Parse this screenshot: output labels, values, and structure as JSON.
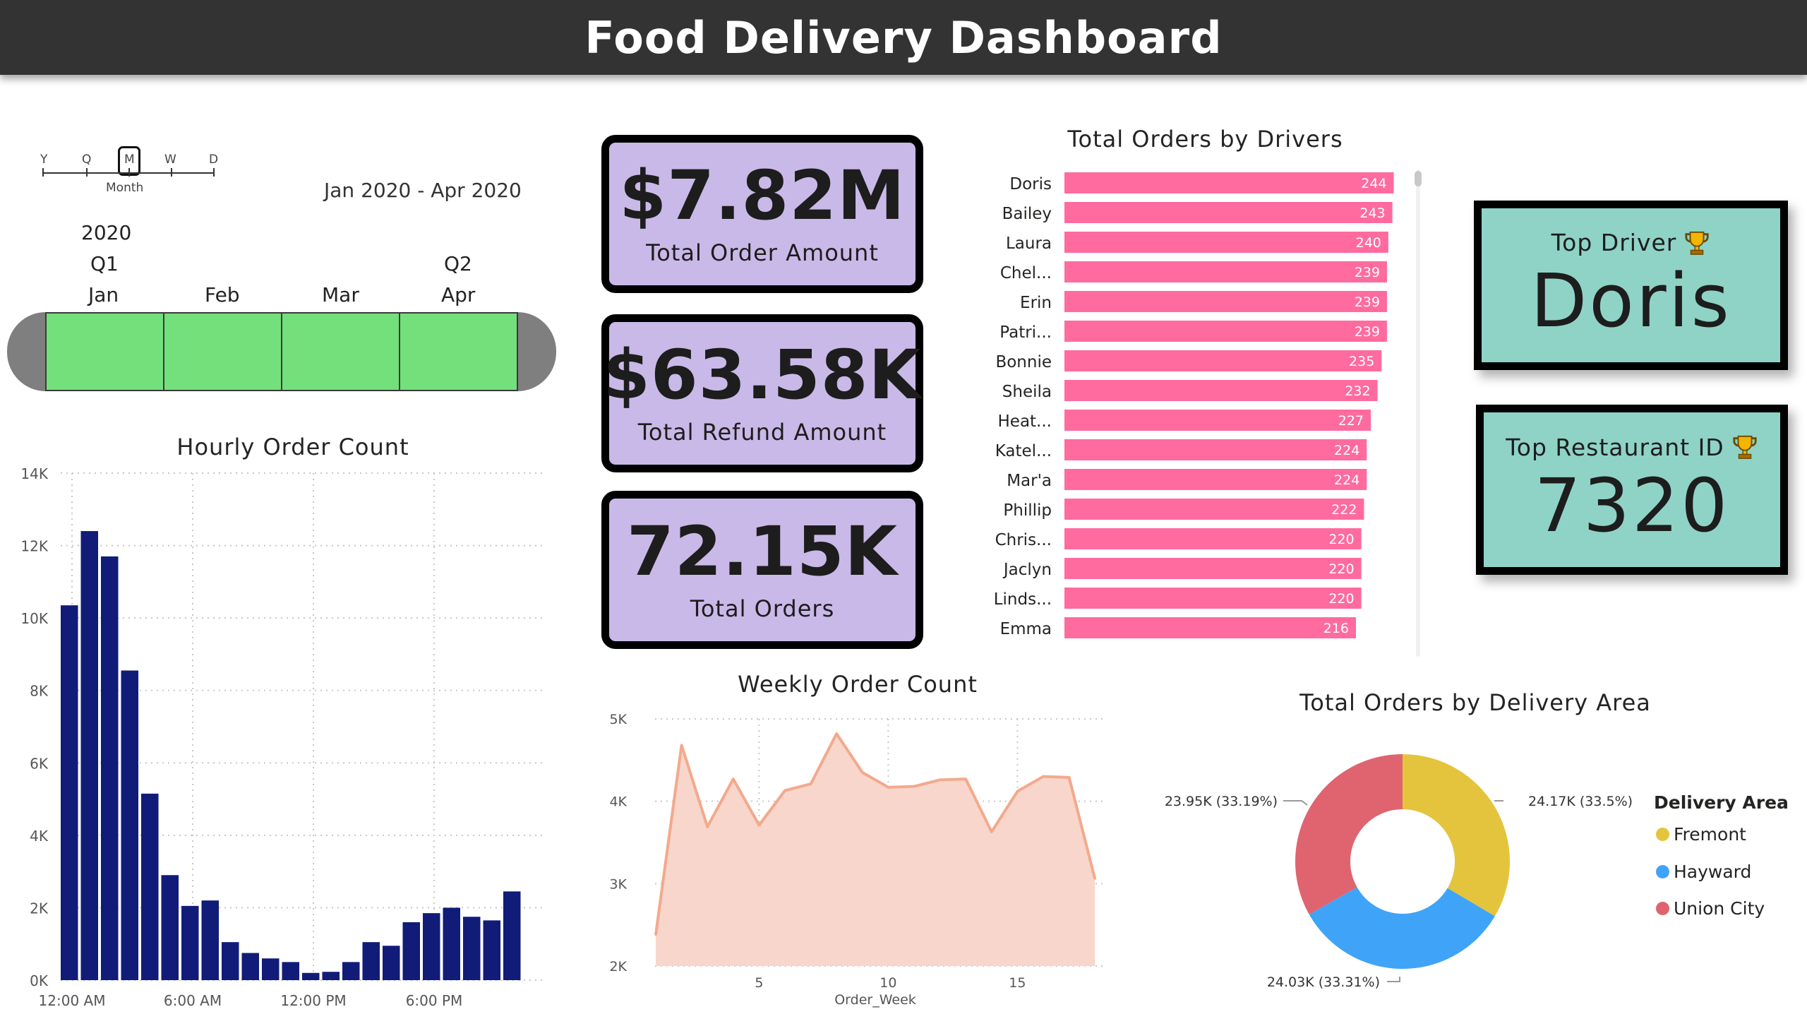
{
  "header": {
    "title": "Food Delivery Dashboard"
  },
  "zoom": {
    "levels": [
      "Y",
      "Q",
      "M",
      "W",
      "D"
    ],
    "selected": "M",
    "label": "Month"
  },
  "timeline": {
    "range": "Jan 2020 - Apr 2020",
    "year": "2020",
    "quarters": [
      "Q1",
      "Q2"
    ],
    "months": [
      "Jan",
      "Feb",
      "Mar",
      "Apr"
    ],
    "selected_color": "#73e07c"
  },
  "kpis": [
    {
      "value": "$7.82M",
      "label": "Total Order Amount"
    },
    {
      "value": "$63.58K",
      "label": "Total Refund Amount"
    },
    {
      "value": "72.15K",
      "label": "Total Orders"
    }
  ],
  "top_driver": {
    "label": "Top Driver",
    "value": "Doris",
    "icon": "trophy-icon"
  },
  "top_restaurant": {
    "label": "Top Restaurant ID",
    "value": "7320",
    "icon": "trophy-icon"
  },
  "colors": {
    "card_purple": "#c9b9e8",
    "card_teal": "#8fd3c7",
    "bar_pink": "#ff6b9e",
    "bar_navy": "#111c78",
    "area_salmon": "#f3a98d"
  },
  "chart_data": [
    {
      "id": "drivers",
      "type": "bar",
      "orientation": "horizontal",
      "title": "Total Orders by Drivers",
      "categories": [
        "Doris",
        "Bailey",
        "Laura",
        "Chel...",
        "Erin",
        "Patri...",
        "Bonnie",
        "Sheila",
        "Heat...",
        "Katel...",
        "Mar'a",
        "Phillip",
        "Chris...",
        "Jaclyn",
        "Linds...",
        "Emma"
      ],
      "values": [
        244,
        243,
        240,
        239,
        239,
        239,
        235,
        232,
        227,
        224,
        224,
        222,
        220,
        220,
        220,
        216
      ],
      "color": "#ff6b9e"
    },
    {
      "id": "hourly",
      "type": "bar",
      "title": "Hourly Order Count",
      "x": [
        "12:00 AM",
        "1:00 AM",
        "2:00 AM",
        "3:00 AM",
        "4:00 AM",
        "5:00 AM",
        "6:00 AM",
        "7:00 AM",
        "8:00 AM",
        "9:00 AM",
        "10:00 AM",
        "11:00 AM",
        "12:00 PM",
        "1:00 PM",
        "2:00 PM",
        "3:00 PM",
        "4:00 PM",
        "5:00 PM",
        "6:00 PM",
        "7:00 PM",
        "8:00 PM",
        "9:00 PM",
        "10:00 PM",
        "11:00 PM"
      ],
      "xticks": [
        "12:00 AM",
        "6:00 AM",
        "12:00 PM",
        "6:00 PM"
      ],
      "values": [
        10350,
        12400,
        11700,
        8550,
        5150,
        2900,
        2050,
        2200,
        1050,
        750,
        600,
        500,
        200,
        230,
        500,
        1050,
        950,
        1600,
        1850,
        2000,
        1750,
        1650,
        2450,
        0
      ],
      "yticks": [
        "0K",
        "2K",
        "4K",
        "6K",
        "8K",
        "10K",
        "12K",
        "14K"
      ],
      "ylim": [
        0,
        14000
      ],
      "color": "#111c78"
    },
    {
      "id": "weekly",
      "type": "area",
      "title": "Weekly Order Count",
      "xlabel": "Order_Week",
      "x": [
        1,
        2,
        3,
        4,
        5,
        6,
        7,
        8,
        9,
        10,
        11,
        12,
        13,
        14,
        15,
        16,
        17,
        18
      ],
      "values": [
        2380,
        4680,
        3690,
        4270,
        3710,
        4130,
        4210,
        4820,
        4350,
        4170,
        4180,
        4260,
        4270,
        3630,
        4120,
        4300,
        4290,
        3060
      ],
      "xticks": [
        5,
        10,
        15
      ],
      "yticks": [
        "2K",
        "3K",
        "4K",
        "5K"
      ],
      "ylim": [
        2000,
        5000
      ],
      "color": "#f3a98d"
    },
    {
      "id": "area",
      "type": "pie",
      "title": "Total Orders by Delivery Area",
      "legend_title": "Delivery Area",
      "slices": [
        {
          "name": "Fremont",
          "value": 24170,
          "label": "24.17K (33.5%)",
          "color": "#e4c43c"
        },
        {
          "name": "Hayward",
          "value": 24030,
          "label": "24.03K (33.31%)",
          "color": "#3fa4f7"
        },
        {
          "name": "Union City",
          "value": 23950,
          "label": "23.95K (33.19%)",
          "color": "#df6470"
        }
      ]
    }
  ]
}
